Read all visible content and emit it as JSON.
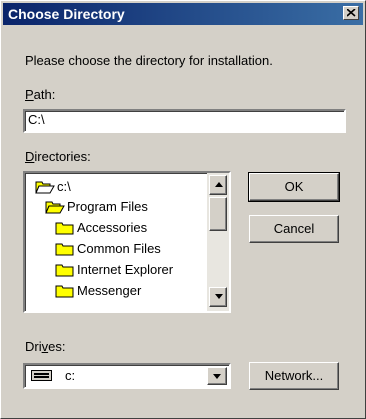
{
  "window": {
    "title": "Choose Directory",
    "close_label": "×"
  },
  "dialog": {
    "instruction": "Please choose the directory for installation.",
    "path_label_accel": "P",
    "path_label_rest": "ath:",
    "path_value": "C:\\",
    "directories_label_accel": "D",
    "directories_label_rest": "irectories:",
    "drives_label_pre": "Dri",
    "drives_label_accel": "v",
    "drives_label_rest": "es:"
  },
  "directories": [
    {
      "label": "c:\\",
      "icon": "open-folder-icon"
    },
    {
      "label": "Program Files",
      "icon": "open-folder-icon"
    },
    {
      "label": "Accessories",
      "icon": "folder-icon"
    },
    {
      "label": "Common Files",
      "icon": "folder-icon"
    },
    {
      "label": "Internet Explorer",
      "icon": "folder-icon"
    },
    {
      "label": "Messenger",
      "icon": "folder-icon"
    }
  ],
  "drive": {
    "selected": "c:",
    "icon": "drive-icon"
  },
  "buttons": {
    "ok": "OK",
    "cancel": "Cancel",
    "network": "Network..."
  },
  "colors": {
    "titlebar_start": "#0a246a",
    "titlebar_end": "#3a6ea5",
    "face": "#d4d0c8",
    "folder": "#ffff00"
  }
}
